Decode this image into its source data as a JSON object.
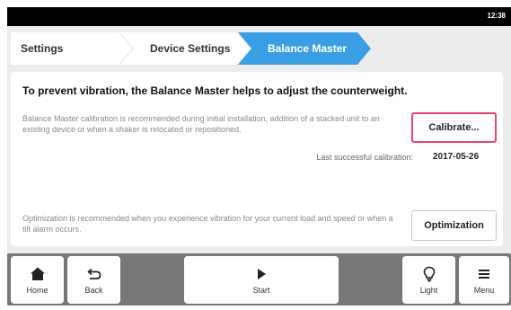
{
  "status": {
    "time": "12:38"
  },
  "breadcrumb": {
    "items": [
      {
        "label": "Settings"
      },
      {
        "label": "Device Settings"
      },
      {
        "label": "Balance Master"
      }
    ],
    "active_color": "#3a9ee4"
  },
  "panel": {
    "headline": "To prevent vibration, the Balance Master helps to adjust the counterweight.",
    "calibration": {
      "description": "Balance Master calibration is recommended during initial installation, addition of a stacked unit to an existing device or when a shaker is relocated or repositioned.",
      "button_label": "Calibrate...",
      "highlight_color": "#e8456b",
      "last_label": "Last successful calibration:",
      "last_value": "2017-05-26"
    },
    "optimization": {
      "description": "Optimization is recommended when you experience vibration for your current load and speed or when a tilt alarm occurs.",
      "button_label": "Optimization"
    }
  },
  "nav": {
    "home": {
      "label": "Home",
      "icon": "home-icon"
    },
    "back": {
      "label": "Back",
      "icon": "back-arrow-icon"
    },
    "start": {
      "label": "Start",
      "icon": "play-icon"
    },
    "light": {
      "label": "Light",
      "icon": "lightbulb-icon"
    },
    "menu": {
      "label": "Menu",
      "icon": "hamburger-menu-icon"
    }
  }
}
